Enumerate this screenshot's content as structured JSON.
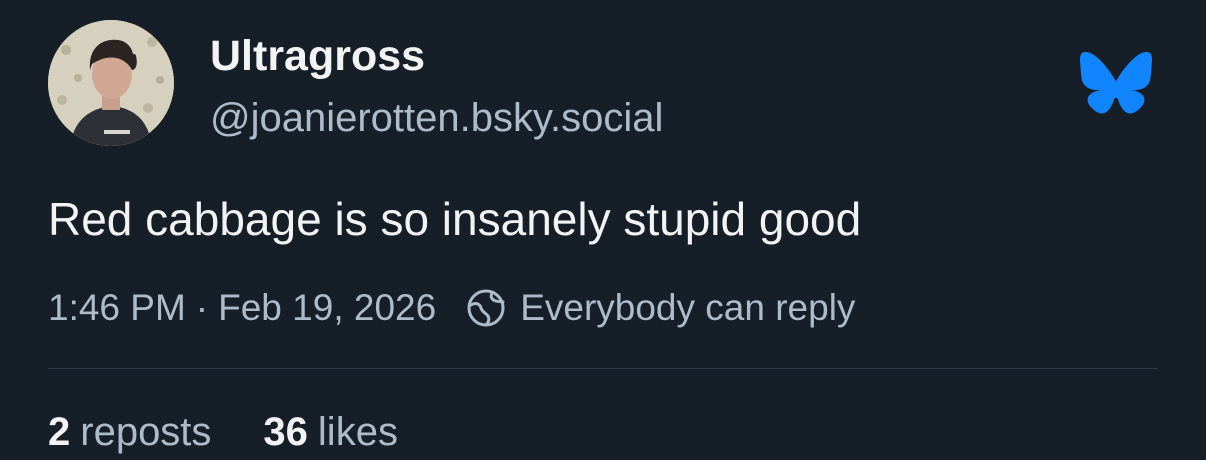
{
  "author": {
    "display_name": "Ultragross",
    "handle": "@joanierotten.bsky.social",
    "avatar_icon": "profile-photo"
  },
  "post": {
    "text": "Red cabbage is so insanely stupid good",
    "time": "1:46 PM",
    "separator": "·",
    "date": "Feb 19, 2026",
    "reply_setting": "Everybody can reply",
    "reply_icon": "globe-icon"
  },
  "stats": {
    "reposts_count": "2",
    "reposts_label": "reposts",
    "likes_count": "36",
    "likes_label": "likes"
  },
  "brand": {
    "logo_icon": "bluesky-butterfly-icon",
    "logo_color": "#1185fe"
  },
  "colors": {
    "background": "#161e27",
    "text_primary": "#f1f3f5",
    "text_secondary": "#aebbc9",
    "divider": "#2c3845"
  }
}
